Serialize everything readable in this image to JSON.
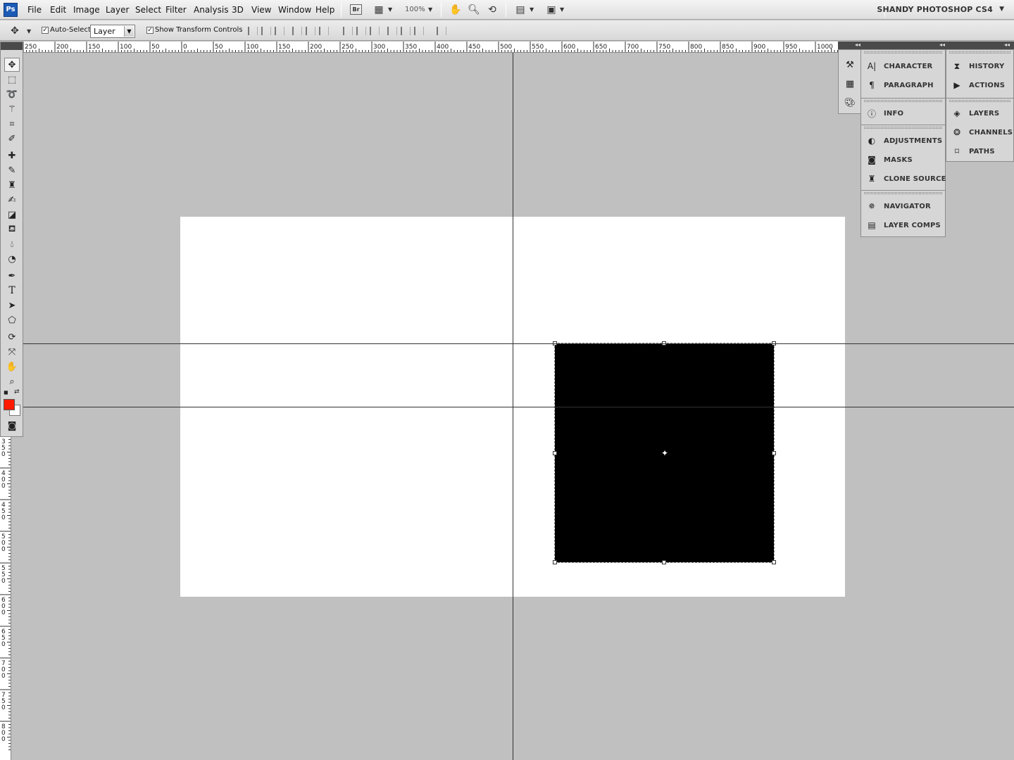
{
  "app": {
    "logo": "Ps",
    "workspace": "SHANDY PHOTOSHOP CS4"
  },
  "menu": [
    "File",
    "Edit",
    "Image",
    "Layer",
    "Select",
    "Filter",
    "Analysis",
    "3D",
    "View",
    "Window",
    "Help"
  ],
  "app_bar": {
    "bridge_label": "Br",
    "zoom": "100%"
  },
  "options": {
    "auto_select_label": "Auto-Select:",
    "auto_select_value": "Layer",
    "show_transform_label": "Show Transform Controls",
    "auto_select_checked": true,
    "show_transform_checked": true
  },
  "ruler_top": [
    "250",
    "200",
    "150",
    "100",
    "50",
    "0",
    "50",
    "100",
    "150",
    "200",
    "250",
    "300",
    "350",
    "400",
    "450",
    "500",
    "550",
    "600",
    "650",
    "700",
    "750",
    "800",
    "850",
    "900",
    "950",
    "1000"
  ],
  "ruler_left": [
    "350",
    "400",
    "450",
    "500",
    "550",
    "600",
    "650",
    "700",
    "750",
    "800"
  ],
  "tools": [
    "move-tool",
    "marquee-tool",
    "lasso-tool",
    "magic-wand-tool",
    "crop-tool",
    "eyedropper-tool",
    "spot-healing-tool",
    "brush-tool",
    "clone-stamp-tool",
    "history-brush-tool",
    "eraser-tool",
    "paint-bucket-tool",
    "blur-tool",
    "dodge-tool",
    "pen-tool",
    "type-tool",
    "path-selection-tool",
    "shape-tool",
    "3d-rotate-tool",
    "3d-orbit-tool",
    "hand-tool",
    "zoom-tool"
  ],
  "colors": {
    "foreground": "#ff1a00",
    "background": "#ffffff",
    "canvas_bg": "#c0c0c0",
    "shape_fill": "#000000"
  },
  "panels": {
    "col1": [
      [
        "CHARACTER",
        "PARAGRAPH"
      ],
      [
        "INFO"
      ],
      [
        "ADJUSTMENTS",
        "MASKS",
        "CLONE SOURCE"
      ],
      [
        "NAVIGATOR",
        "LAYER COMPS"
      ]
    ],
    "col2": [
      [
        "HISTORY",
        "ACTIONS"
      ],
      [
        "LAYERS",
        "CHANNELS",
        "PATHS"
      ]
    ]
  }
}
